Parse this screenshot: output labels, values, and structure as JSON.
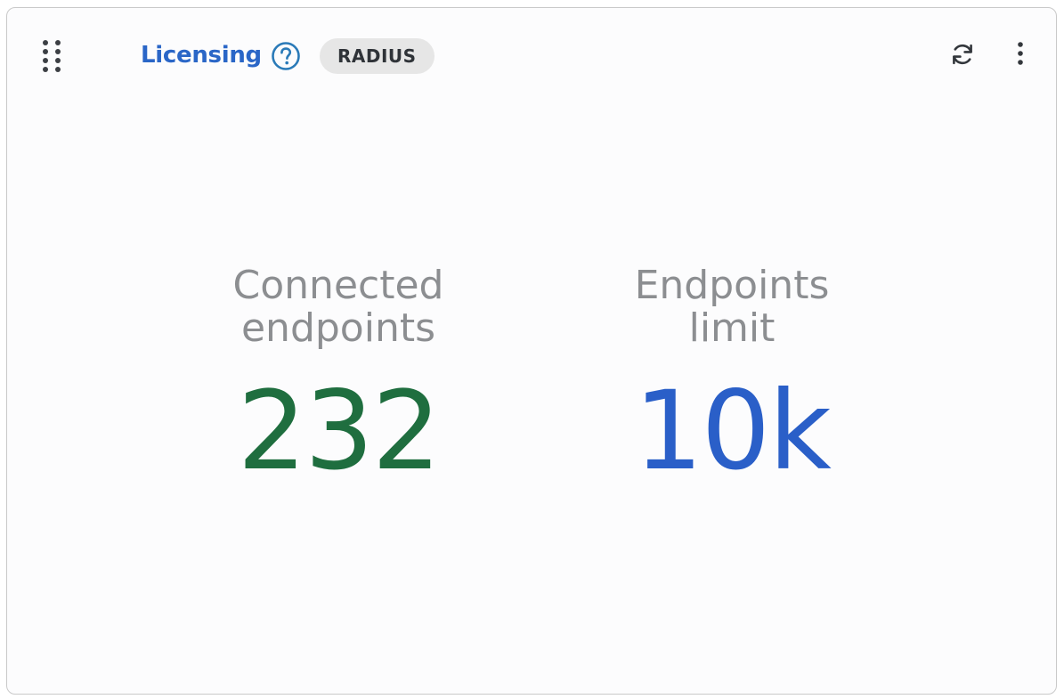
{
  "header": {
    "title": "Licensing",
    "badge": "RADIUS",
    "icons": {
      "drag": "drag-handle-icon",
      "help": "help-circle-icon",
      "refresh": "refresh-icon",
      "more": "more-vertical-icon"
    }
  },
  "metrics": {
    "connected": {
      "label_line1": "Connected",
      "label_line2": "endpoints",
      "value": "232",
      "color": "#1f6e3f"
    },
    "limit": {
      "label_line1": "Endpoints",
      "label_line2": "limit",
      "value": "10k",
      "color": "#2a5fc8"
    }
  },
  "colors": {
    "title": "#2a66c7",
    "label": "#8c8e91",
    "badge_bg": "#e6e6e6"
  }
}
